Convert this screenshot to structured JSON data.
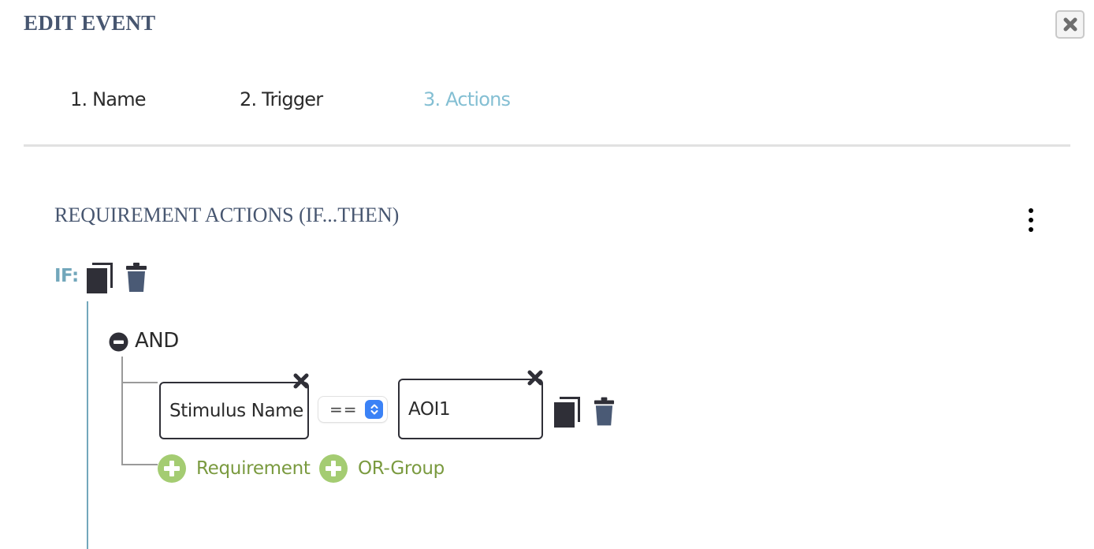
{
  "dialog": {
    "title": "EDIT EVENT",
    "close_icon": "close-x-icon"
  },
  "tabs": [
    {
      "label": "1. Name",
      "active": false
    },
    {
      "label": "2. Trigger",
      "active": false
    },
    {
      "label": "3. Actions",
      "active": true
    }
  ],
  "section": {
    "title": "REQUIREMENT ACTIONS (IF...THEN)",
    "menu_icon": "kebab-menu-icon"
  },
  "if_block": {
    "label": "IF:",
    "copy_icon": "copy-icon",
    "delete_icon": "trash-icon",
    "group": {
      "operator_label": "AND",
      "collapse_icon": "minus-circle-icon",
      "requirements": [
        {
          "left_value": "Stimulus Name",
          "comparator": "==",
          "right_value": "AOI1"
        }
      ],
      "add_requirement_label": "Requirement",
      "add_or_group_label": "OR-Group"
    }
  },
  "colors": {
    "title": "#475670",
    "active_tab": "#84bfd3",
    "if_accent": "#72a7bb",
    "add_green": "#a4cc72",
    "add_text": "#7a9a3f",
    "select_blue": "#3b82f6",
    "dark_icon": "#2f2f37",
    "trash": "#4a5a75"
  }
}
